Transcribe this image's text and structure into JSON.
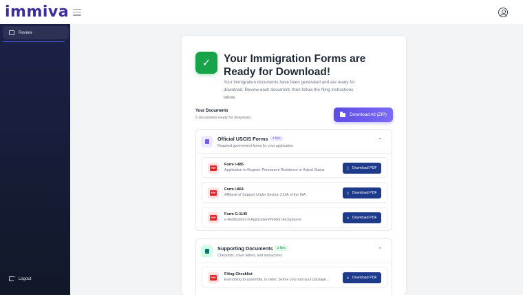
{
  "app": {
    "logo": "immiva"
  },
  "sidebar": {
    "items": [
      {
        "label": "Review",
        "icon": "review-icon"
      }
    ],
    "logout_label": "Logout"
  },
  "hero": {
    "title": "Your Immigration Forms are Ready for Download!",
    "description": "Your immigration documents have been generated and are ready for download. Review each document, then follow the filing instructions below."
  },
  "documents": {
    "heading": "Your Documents",
    "count_text": "5 documents ready for download",
    "zip_button": "Download All (ZIP)"
  },
  "sections": [
    {
      "title": "Official USCIS Forms",
      "badge": "3 files",
      "subtitle": "Required government forms for your application",
      "items": [
        {
          "icon_text": "PDF",
          "title": "Form I-485",
          "description": "Application to Register Permanent Residence or Adjust Status",
          "button": "Download PDF"
        },
        {
          "icon_text": "PDF",
          "title": "Form I-864",
          "description": "Affidavit of Support Under Section 213A of the INA",
          "button": "Download PDF"
        },
        {
          "icon_text": "PDF",
          "title": "Form G-1145",
          "description": "e-Notification of Application/Petition Acceptance",
          "button": "Download PDF"
        }
      ]
    },
    {
      "title": "Supporting Documents",
      "badge": "2 files",
      "subtitle": "Checklists, cover letters, and instructions",
      "items": [
        {
          "icon_text": "PDF",
          "title": "Filing Checklist",
          "description": "Everything to assemble, in order, before you mail your package...",
          "button": "Download PDF"
        }
      ]
    }
  ],
  "colors": {
    "brand": "#3b2c9e",
    "success": "#16a34a",
    "primary_button": "#1e3a8a",
    "zip_button": "#5b4ce6"
  }
}
